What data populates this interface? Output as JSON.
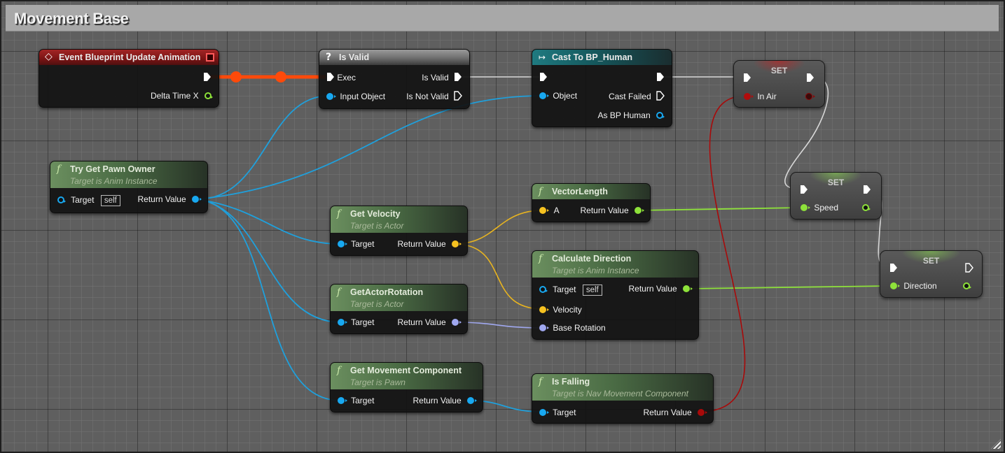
{
  "comment": {
    "title": "Movement Base"
  },
  "colors": {
    "exec_wire": "#ff4a0a",
    "object_pin": "#18a8f0",
    "vector_pin": "#f5c120",
    "float_pin": "#8ee23a",
    "rotator_pin": "#a0a8f0",
    "bool_pin": "#a80a0a",
    "exec_pin": "#ffffff"
  },
  "nodes": {
    "event_update": {
      "title": "Event Blueprint Update Animation",
      "icon": "event-diamond-icon",
      "pins_out": [
        "",
        "Delta Time X"
      ]
    },
    "is_valid": {
      "title": "Is Valid",
      "icon": "question-mark-icon",
      "pins_in": [
        "Exec",
        "Input Object"
      ],
      "pins_out": [
        "Is Valid",
        "Is Not Valid"
      ]
    },
    "cast": {
      "title": "Cast To BP_Human",
      "icon": "cast-arrow-icon",
      "pins_in": [
        "",
        "Object"
      ],
      "pins_out": [
        "",
        "Cast Failed",
        "As BP Human"
      ]
    },
    "set_in_air": {
      "title": "SET",
      "var": "In Air"
    },
    "set_speed": {
      "title": "SET",
      "var": "Speed"
    },
    "set_direction": {
      "title": "SET",
      "var": "Direction"
    },
    "try_get_pawn": {
      "title": "Try Get Pawn Owner",
      "subtitle": "Target is Anim Instance",
      "pin_in": "Target",
      "self_label": "self",
      "pin_out": "Return Value"
    },
    "get_velocity": {
      "title": "Get Velocity",
      "subtitle": "Target is Actor",
      "pin_in": "Target",
      "pin_out": "Return Value"
    },
    "get_actor_rotation": {
      "title": "GetActorRotation",
      "subtitle": "Target is Actor",
      "pin_in": "Target",
      "pin_out": "Return Value"
    },
    "get_movement_component": {
      "title": "Get Movement Component",
      "subtitle": "Target is Pawn",
      "pin_in": "Target",
      "pin_out": "Return Value"
    },
    "vector_length": {
      "title": "VectorLength",
      "pin_in": "A",
      "pin_out": "Return Value"
    },
    "calculate_direction": {
      "title": "Calculate Direction",
      "subtitle": "Target is Anim Instance",
      "pins_in": [
        "Target",
        "Velocity",
        "Base Rotation"
      ],
      "self_label": "self",
      "pin_out": "Return Value"
    },
    "is_falling": {
      "title": "Is Falling",
      "subtitle": "Target is Nav Movement Component",
      "pin_in": "Target",
      "pin_out": "Return Value"
    }
  },
  "function_icon": "f"
}
